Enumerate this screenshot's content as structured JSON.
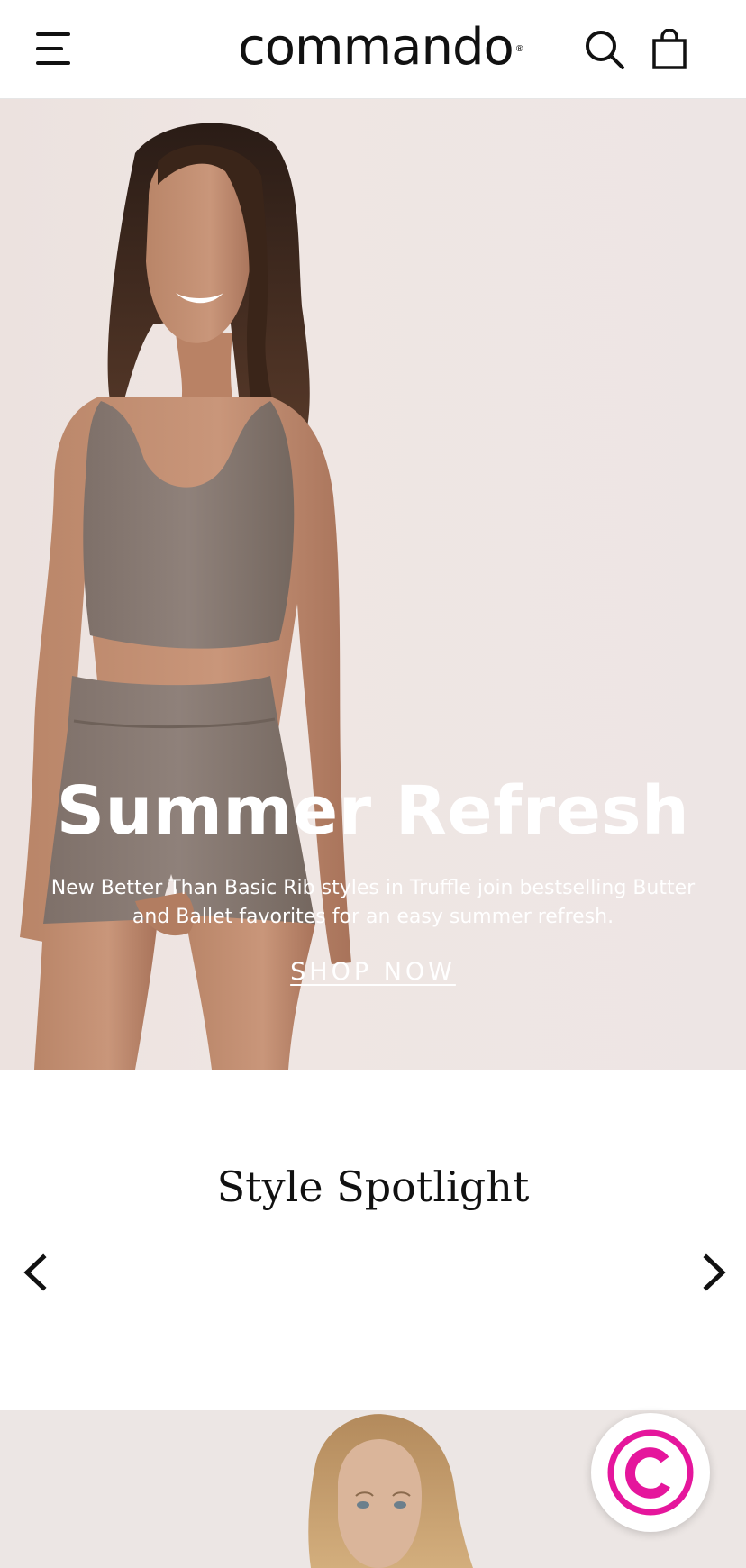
{
  "header": {
    "brand": "commando",
    "brand_mark": "®",
    "icons": {
      "menu": "hamburger-menu-icon",
      "search": "search-icon",
      "bag": "shopping-bag-icon"
    }
  },
  "hero": {
    "title": "Summer Refresh",
    "subtitle": "New Better Than Basic Rib styles in Truffle join bestselling Butter and Ballet favorites for an easy summer refresh.",
    "cta": "SHOP NOW",
    "text_color": "#ffffff"
  },
  "spotlight": {
    "title": "Style Spotlight",
    "prev_icon": "chevron-left-icon",
    "next_icon": "chevron-right-icon"
  },
  "chat": {
    "icon": "commando-c-logo-icon",
    "accent": "#e5169c"
  }
}
